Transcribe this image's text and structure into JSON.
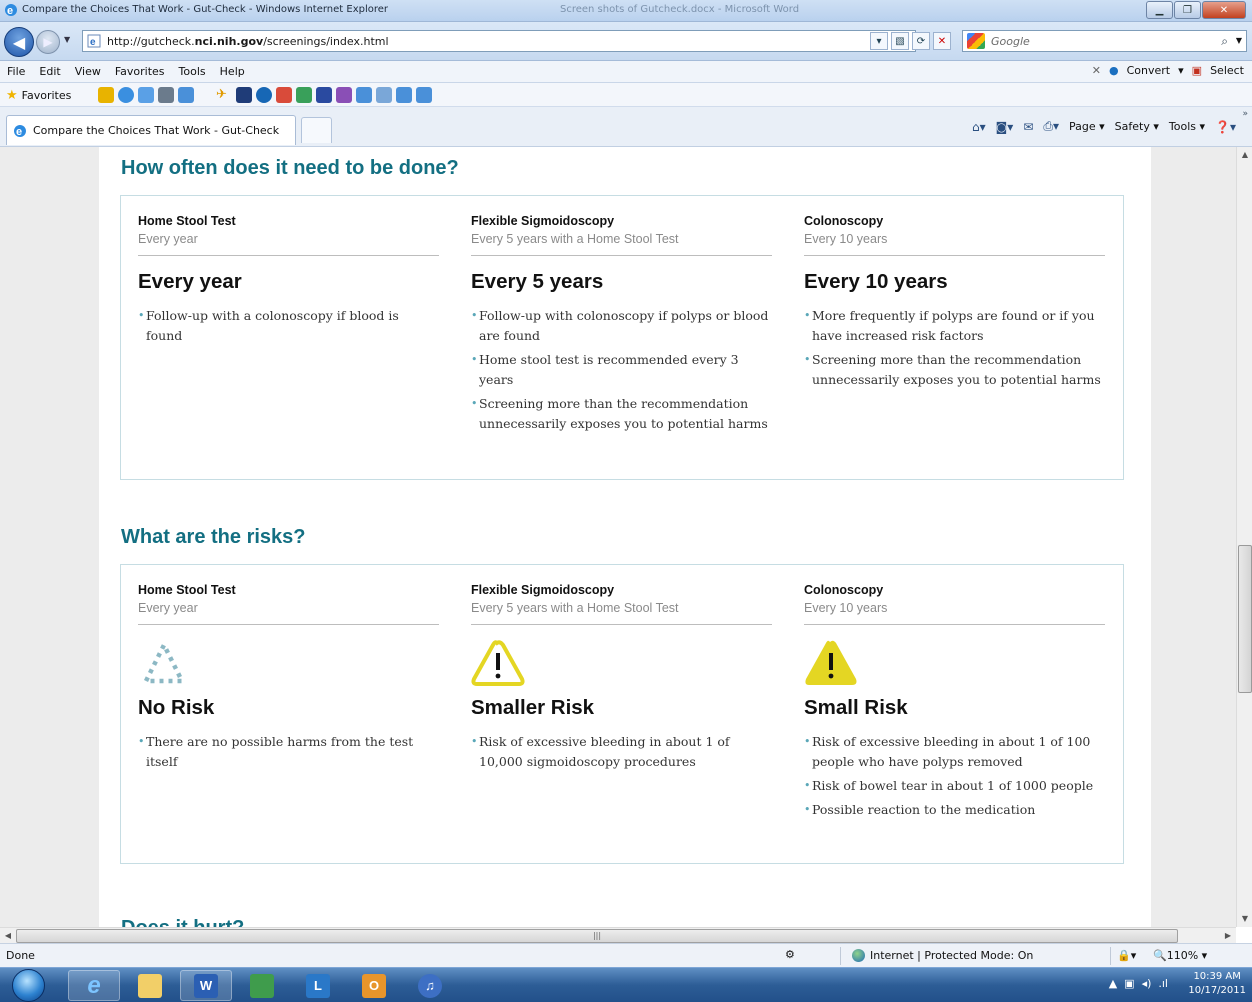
{
  "window": {
    "title": "Compare the Choices That Work - Gut-Check - Windows Internet Explorer",
    "background_title": "Screen shots of Gutcheck.docx - Microsoft Word"
  },
  "address": {
    "url_prefix": "http://gutcheck.",
    "url_domain": "nci.nih.gov",
    "url_path": "/screenings/index.html",
    "search_placeholder": "Google"
  },
  "menu": {
    "items": [
      "File",
      "Edit",
      "View",
      "Favorites",
      "Tools",
      "Help"
    ],
    "convert": "Convert",
    "select": "Select"
  },
  "favorites": {
    "label": "Favorites"
  },
  "tab": {
    "title": "Compare the Choices That Work - Gut-Check"
  },
  "command_bar": {
    "page": "Page",
    "safety": "Safety",
    "tools": "Tools"
  },
  "sections": [
    {
      "heading": "How often does it need to be done?",
      "columns": [
        {
          "name": "Home Stool Test",
          "frequency": "Every year",
          "headline": "Every year",
          "bullets": [
            "Follow-up with a colonoscopy if blood is found"
          ]
        },
        {
          "name": "Flexible Sigmoidoscopy",
          "frequency": "Every 5 years with a Home Stool Test",
          "headline": "Every 5 years",
          "bullets": [
            "Follow-up with colonoscopy if polyps or blood are found",
            "Home stool test is recommended every 3 years",
            "Screening more than the recommendation unnecessarily exposes you to potential harms"
          ]
        },
        {
          "name": "Colonoscopy",
          "frequency": "Every 10 years",
          "headline": "Every 10 years",
          "bullets": [
            "More frequently if polyps are found or if you have increased risk factors",
            "Screening more than the recommendation unnecessarily exposes you to potential harms"
          ]
        }
      ]
    },
    {
      "heading": "What are the risks?",
      "columns": [
        {
          "name": "Home Stool Test",
          "frequency": "Every year",
          "icon": "no-risk-dotted-triangle-icon",
          "headline": "No Risk",
          "bullets": [
            "There are no possible harms from the test itself"
          ]
        },
        {
          "name": "Flexible Sigmoidoscopy",
          "frequency": "Every 5 years with a Home Stool Test",
          "icon": "smaller-risk-outline-warning-icon",
          "headline": "Smaller Risk",
          "bullets": [
            "Risk of excessive bleeding in about 1 of 10,000 sigmoidoscopy procedures"
          ]
        },
        {
          "name": "Colonoscopy",
          "frequency": "Every 10 years",
          "icon": "small-risk-filled-warning-icon",
          "headline": "Small Risk",
          "bullets": [
            "Risk of excessive bleeding in about 1 of 100 people who have polyps removed",
            "Risk of bowel tear in about 1 of 1000 people",
            "Possible reaction to the medication"
          ]
        }
      ]
    }
  ],
  "partial_heading": "Does it hurt?",
  "status": {
    "left": "Done",
    "zone": "Internet | Protected Mode: On",
    "zoom": "110%"
  },
  "taskbar": {
    "time": "10:39 AM",
    "date": "10/17/2011"
  },
  "colors": {
    "heading": "#136f82",
    "risk_yellow": "#e4d623",
    "bullet": "#5aa7b8"
  }
}
